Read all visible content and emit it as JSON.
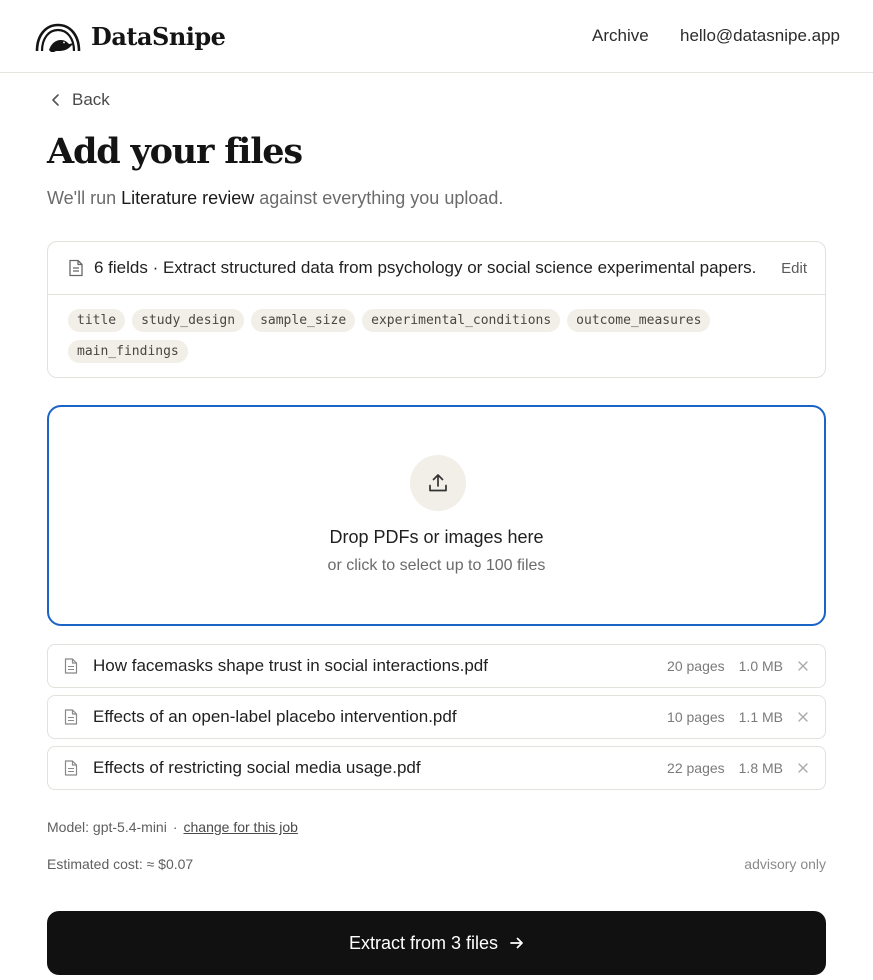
{
  "header": {
    "brand": "DataSnipe",
    "logo_icon": "bird-in-arch-logo",
    "nav": {
      "archive": "Archive",
      "email": "hello@datasnipe.app"
    }
  },
  "back": {
    "label": "Back",
    "icon": "chevron-left-icon"
  },
  "page": {
    "title": "Add your files",
    "subtitle_prefix": "We'll run ",
    "subtitle_emphasis": "Literature review",
    "subtitle_suffix": " against everything you upload."
  },
  "schema": {
    "icon": "document-icon",
    "description": "6 fields · Extract structured data from psychology or social science experimental papers.",
    "edit_label": "Edit",
    "fields": [
      "title",
      "study_design",
      "sample_size",
      "experimental_conditions",
      "outcome_measures",
      "main_findings"
    ]
  },
  "dropzone": {
    "icon": "upload-icon",
    "title": "Drop PDFs or images here",
    "subtitle": "or click to select up to 100 files",
    "border_color": "#1a64c7"
  },
  "files": [
    {
      "name": "How facemasks shape trust in social interactions.pdf",
      "pages": "20 pages",
      "size": "1.0 MB"
    },
    {
      "name": "Effects of an open-label placebo intervention.pdf",
      "pages": "10 pages",
      "size": "1.1 MB"
    },
    {
      "name": "Effects of restricting social media usage.pdf",
      "pages": "22 pages",
      "size": "1.8 MB"
    }
  ],
  "footer": {
    "model_label": "Model: gpt-5.4-mini",
    "separator": "·",
    "change_link": "change for this job",
    "cost": "Estimated cost: ≈ $0.07",
    "advisory": "advisory only"
  },
  "cta": {
    "label": "Extract from 3 files",
    "icon": "arrow-right-icon",
    "background": "#111111"
  }
}
